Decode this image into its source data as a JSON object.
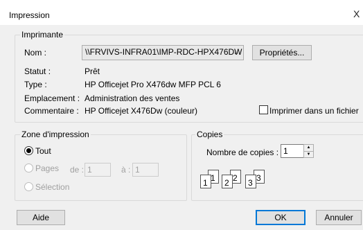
{
  "window": {
    "title": "Impression",
    "close_glyph": "X"
  },
  "printer": {
    "legend": "Imprimante",
    "name_label": "Nom :",
    "name_value": "\\\\FRVIVS-INFRA01\\IMP-RDC-HPX476DW",
    "properties_button": "Propriétés...",
    "status_label": "Statut :",
    "status_value": "Prêt",
    "type_label": "Type :",
    "type_value": "HP Officejet Pro X476dw MFP PCL 6",
    "location_label": "Emplacement :",
    "location_value": "Administration des ventes",
    "comment_label": "Commentaire :",
    "comment_value": "HP Officejet X476Dw (couleur)",
    "print_to_file_label": "Imprimer dans un fichier"
  },
  "print_range": {
    "legend": "Zone d'impression",
    "all_label": "Tout",
    "pages_label": "Pages",
    "from_label": "de :",
    "from_value": "1",
    "to_label": "à :",
    "to_value": "1",
    "selection_label": "Sélection"
  },
  "copies": {
    "legend": "Copies",
    "count_label": "Nombre de copies :",
    "count_value": "1",
    "collate_pages": [
      "1",
      "1",
      "2",
      "2",
      "3",
      "3"
    ]
  },
  "footer": {
    "help_button": "Aide",
    "ok_button": "OK",
    "cancel_button": "Annuler"
  }
}
